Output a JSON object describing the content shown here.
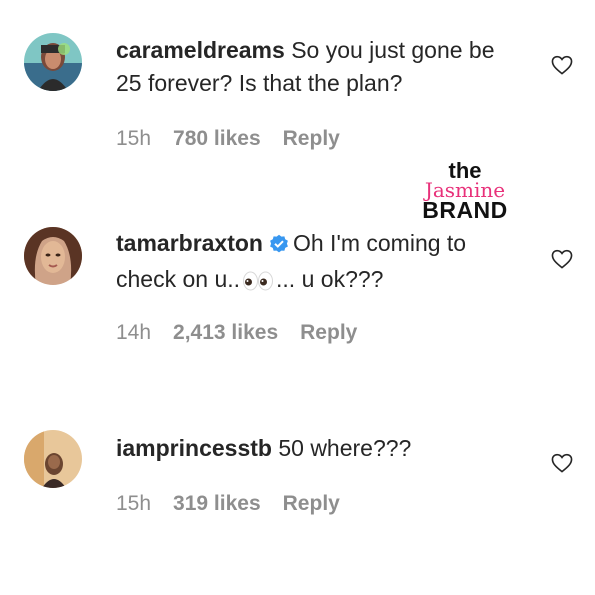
{
  "watermark": {
    "line1": "the",
    "line2": "Jasmine",
    "line3": "BRAND"
  },
  "comments": [
    {
      "username": "carameldreams",
      "text": "So you just gone be 25 forever? Is that the plan?",
      "time": "15h",
      "likes": "780 likes",
      "reply": "Reply",
      "verified": false,
      "avatar_icon": "user-avatar-photo"
    },
    {
      "username": "tamarbraxton",
      "text_before": "Oh I'm coming to check on u..",
      "text_after": "... u ok???",
      "time": "14h",
      "likes": "2,413 likes",
      "reply": "Reply",
      "verified": true,
      "emoji": "eyes-emoji",
      "avatar_icon": "user-avatar-photo"
    },
    {
      "username": "iamprincesstb",
      "text": "50 where???",
      "time": "15h",
      "likes": "319 likes",
      "reply": "Reply",
      "verified": false,
      "avatar_icon": "user-avatar-photo"
    }
  ],
  "colors": {
    "text": "#262626",
    "meta": "#8e8e8e",
    "verified_blue": "#3897f0",
    "watermark_pink": "#e8317a"
  }
}
